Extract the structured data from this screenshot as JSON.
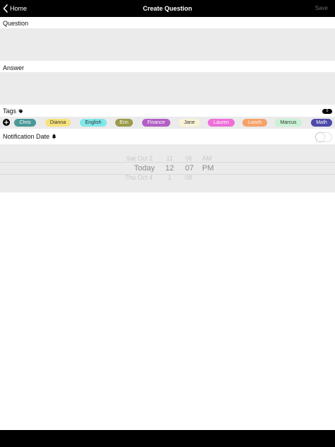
{
  "nav": {
    "back_label": "Home",
    "title": "Create Question",
    "save_label": "Save"
  },
  "question": {
    "label": "Question",
    "value": "",
    "placeholder": ""
  },
  "answer": {
    "label": "Answer",
    "value": "",
    "placeholder": ""
  },
  "tags": {
    "label": "Tags",
    "label_icon": "tag-icon",
    "count": "0",
    "add_icon": "plus-circle-icon",
    "items": [
      {
        "label": "Chris",
        "bg": "#4a9999",
        "fg": "#ffffff"
      },
      {
        "label": "Dianna",
        "bg": "#f6e27a",
        "fg": "#333333"
      },
      {
        "label": "English",
        "bg": "#7fe8ea",
        "fg": "#333333"
      },
      {
        "label": "Erin",
        "bg": "#9a9a4a",
        "fg": "#ffffff"
      },
      {
        "label": "Finance",
        "bg": "#b35fc6",
        "fg": "#ffffff"
      },
      {
        "label": "Jane",
        "bg": "#f8f3d6",
        "fg": "#333333"
      },
      {
        "label": "Lauren",
        "bg": "#ee6fd9",
        "fg": "#ffffff"
      },
      {
        "label": "Lunch",
        "bg": "#f4a26a",
        "fg": "#ffffff"
      },
      {
        "label": "Marcus",
        "bg": "#c9f2d4",
        "fg": "#333333"
      },
      {
        "label": "Math",
        "bg": "#4d4aa8",
        "fg": "#ffffff"
      }
    ]
  },
  "notification": {
    "label": "Notification Date",
    "label_icon": "bell-icon",
    "enabled": false
  },
  "date_picker": {
    "days": [
      "Sat Oct 2",
      "Today",
      "Thu Oct 4"
    ],
    "hours": [
      "11",
      "12",
      "1"
    ],
    "minutes": [
      "06",
      "07",
      "08"
    ],
    "periods": [
      "AM",
      "PM"
    ],
    "selected": {
      "day": "Today",
      "hour": "12",
      "minute": "07",
      "period": "PM"
    }
  }
}
